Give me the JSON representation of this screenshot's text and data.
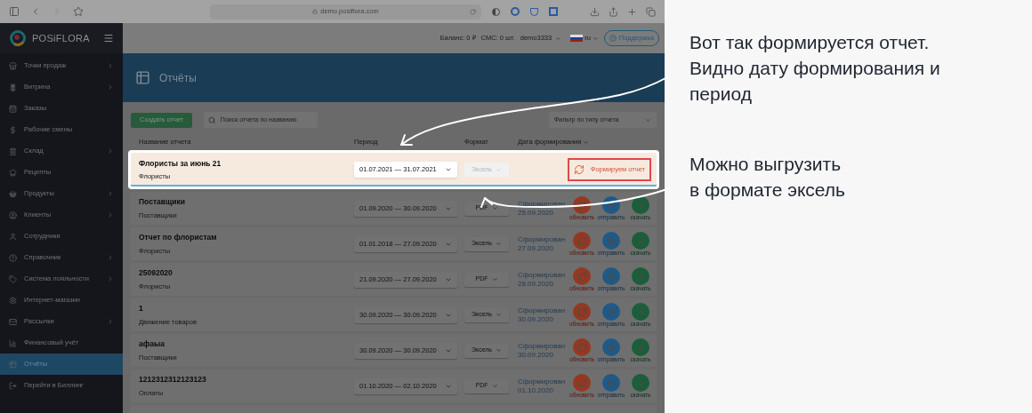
{
  "browser": {
    "url": "demo.posiflora.com"
  },
  "sidebar": {
    "logo": "POSiFLORA",
    "items": [
      {
        "label": "Точки продаж",
        "has_submenu": true,
        "selected": false
      },
      {
        "label": "Витрина",
        "has_submenu": true,
        "selected": false
      },
      {
        "label": "Заказы",
        "has_submenu": false,
        "selected": false
      },
      {
        "label": "Рабочие смены",
        "has_submenu": false,
        "selected": false
      },
      {
        "label": "Склад",
        "has_submenu": true,
        "selected": false
      },
      {
        "label": "Рецепты",
        "has_submenu": false,
        "selected": false
      },
      {
        "label": "Продукты",
        "has_submenu": true,
        "selected": false
      },
      {
        "label": "Клиенты",
        "has_submenu": true,
        "selected": false
      },
      {
        "label": "Сотрудники",
        "has_submenu": false,
        "selected": false
      },
      {
        "label": "Справочник",
        "has_submenu": true,
        "selected": false
      },
      {
        "label": "Система лояльности",
        "has_submenu": true,
        "selected": false
      },
      {
        "label": "Интернет-магазин",
        "has_submenu": false,
        "selected": false
      },
      {
        "label": "Рассылки",
        "has_submenu": true,
        "selected": false
      },
      {
        "label": "Финансовый учёт",
        "has_submenu": false,
        "selected": false
      },
      {
        "label": "Отчёты",
        "has_submenu": false,
        "selected": true
      },
      {
        "label": "Перейти в Биллинг",
        "has_submenu": false,
        "selected": false
      }
    ]
  },
  "header": {
    "balance": "Баланс: 0 ₽",
    "sms": "СМС: 0 шт.",
    "user": "demo3333",
    "language": "ru",
    "support": "Поддержка"
  },
  "page_title": "Отчёты",
  "toolbar": {
    "create_button": "Создать отчет",
    "search_placeholder": "Поиск отчета по названию",
    "filter_placeholder": "Фильтр по типу отчета"
  },
  "table": {
    "columns": [
      "Название отчета",
      "Период",
      "Формат",
      "Дата формирования"
    ],
    "rows": [
      {
        "kind": "generating",
        "highlighted": true,
        "title": "Флористы за июнь 21",
        "type": "Флористы",
        "period": "01.07.2021 — 31.07.2021",
        "format": "Эксель",
        "progress": "Формируем отчет"
      },
      {
        "kind": "ready",
        "highlighted": false,
        "title": "Поставщики",
        "type": "Поставщики",
        "period": "01.09.2020 — 30.09.2020",
        "format": "PDF",
        "status": "Сформирован",
        "date": "25.09.2020",
        "actions": [
          "обновить",
          "отправить",
          "скачать"
        ]
      },
      {
        "kind": "ready",
        "highlighted": false,
        "title": "Отчет по флористам",
        "type": "Флористы",
        "period": "01.01.2018 — 27.09.2020",
        "format": "Эксель",
        "status": "Сформирован",
        "date": "27.09.2020",
        "actions": [
          "обновить",
          "отправить",
          "скачать"
        ]
      },
      {
        "kind": "ready",
        "highlighted": false,
        "title": "25092020",
        "type": "Флористы",
        "period": "21.09.2020 — 27.09.2020",
        "format": "PDF",
        "status": "Сформирован",
        "date": "28.09.2020",
        "actions": [
          "обновить",
          "отправить",
          "скачать"
        ]
      },
      {
        "kind": "ready",
        "highlighted": false,
        "title": "1",
        "type": "Движение товаров",
        "period": "30.09.2020 — 30.09.2020",
        "format": "Эксель",
        "status": "Сформирован",
        "date": "30.09.2020",
        "actions": [
          "обновить",
          "отправить",
          "скачать"
        ]
      },
      {
        "kind": "ready",
        "highlighted": false,
        "title": "афаыа",
        "type": "Поставщики",
        "period": "30.09.2020 — 30.09.2020",
        "format": "Эксель",
        "status": "Сформирован",
        "date": "30.09.2020",
        "actions": [
          "обновить",
          "отправить",
          "скачать"
        ]
      },
      {
        "kind": "ready",
        "highlighted": false,
        "title": "1212312312123123",
        "type": "Оплаты",
        "period": "01.10.2020 — 02.10.2020",
        "format": "PDF",
        "status": "Сформирован",
        "date": "01.10.2020",
        "actions": [
          "обновить",
          "отправить",
          "скачать"
        ]
      }
    ]
  },
  "annotations": [
    {
      "text": "Вот так формируется отчет. Видно дату формирования и период"
    },
    {
      "text": "Можно выгрузить в формате эксель"
    }
  ]
}
